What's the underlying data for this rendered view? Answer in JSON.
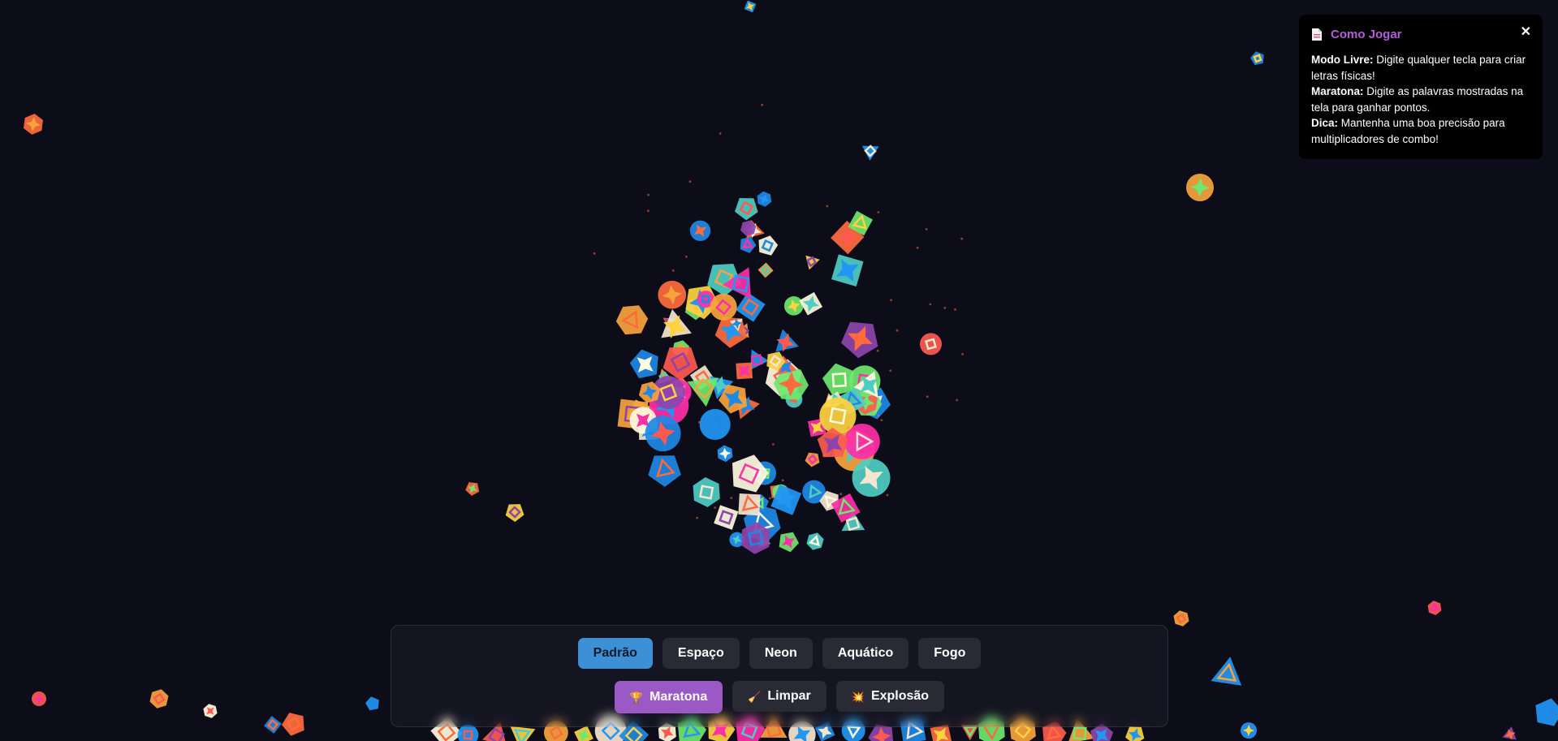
{
  "help": {
    "icon": "document-icon",
    "title": "Como Jogar",
    "close": "✕",
    "lines": [
      {
        "label": "Modo Livre:",
        "text": " Digite qualquer tecla para criar letras físicas!"
      },
      {
        "label": "Maratona:",
        "text": " Digite as palavras mostradas na tela para ganhar pontos."
      },
      {
        "label": "Dica:",
        "text": " Mantenha uma boa precisão para multiplicadores de combo!"
      }
    ]
  },
  "themes": {
    "active": "Padrão",
    "buttons": [
      "Padrão",
      "Espaço",
      "Neon",
      "Aquático",
      "Fogo"
    ]
  },
  "actions": {
    "marathon": {
      "icon": "🏆",
      "icon_name": "trophy-icon",
      "label": "Maratona"
    },
    "clear": {
      "icon": "🧹",
      "icon_name": "broom-icon",
      "label": "Limpar"
    },
    "explode": {
      "icon": "💥",
      "icon_name": "explosion-icon",
      "label": "Explosão"
    }
  },
  "colors": {
    "background": "#0d0d1a",
    "accent_theme": "#3d8fd6",
    "accent_marathon": "#9b59c6",
    "title": "#b15ed8",
    "shape_palette": [
      "#ff6b3d",
      "#ffd23f",
      "#2196f3",
      "#f5e6d0",
      "#ff2fa8",
      "#f7a33c",
      "#4ecdc4",
      "#6ee86e",
      "#8e44ad",
      "#ff5a4f",
      "#fffbe0",
      "#1e88e5"
    ]
  }
}
